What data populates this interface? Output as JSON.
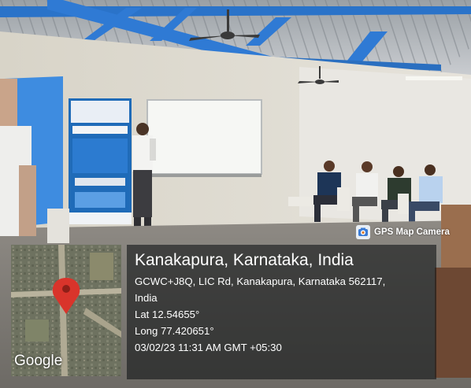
{
  "stamp": {
    "app_name": "GPS Map Camera",
    "place_title": "Kanakapura, Karnataka, India",
    "address_line1": "GCWC+J8Q, LIC Rd, Kanakapura, Karnataka 562117,",
    "address_line2": "India",
    "latitude": "Lat 12.54655°",
    "longitude": "Long 77.420651°",
    "datetime": "03/02/23 11:31 AM GMT +05:30"
  },
  "map": {
    "provider_label": "Google",
    "pin_color": "#d9342b"
  },
  "icons": [
    "camera-icon",
    "map-pin-icon"
  ]
}
